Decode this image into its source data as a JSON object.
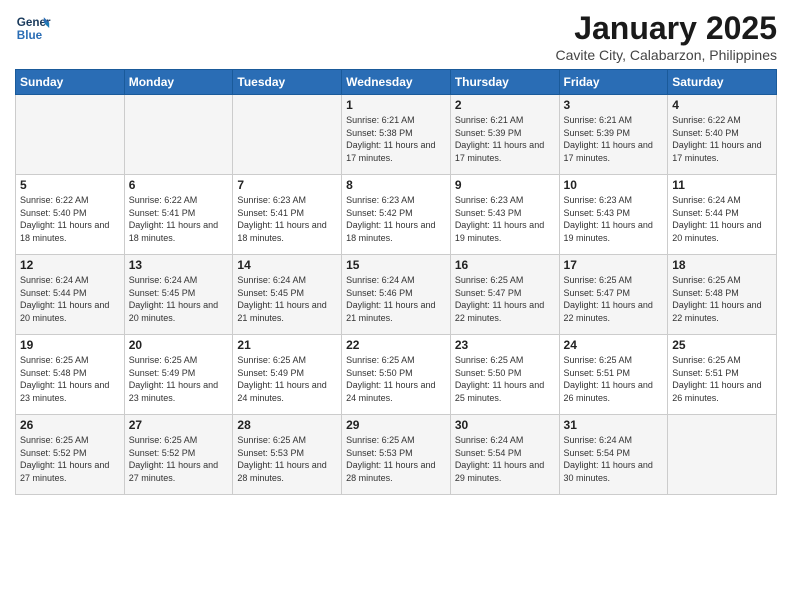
{
  "logo": {
    "line1": "General",
    "line2": "Blue"
  },
  "title": "January 2025",
  "subtitle": "Cavite City, Calabarzon, Philippines",
  "days_of_week": [
    "Sunday",
    "Monday",
    "Tuesday",
    "Wednesday",
    "Thursday",
    "Friday",
    "Saturday"
  ],
  "weeks": [
    [
      {
        "day": "",
        "sunrise": "",
        "sunset": "",
        "daylight": ""
      },
      {
        "day": "",
        "sunrise": "",
        "sunset": "",
        "daylight": ""
      },
      {
        "day": "",
        "sunrise": "",
        "sunset": "",
        "daylight": ""
      },
      {
        "day": "1",
        "sunrise": "Sunrise: 6:21 AM",
        "sunset": "Sunset: 5:38 PM",
        "daylight": "Daylight: 11 hours and 17 minutes."
      },
      {
        "day": "2",
        "sunrise": "Sunrise: 6:21 AM",
        "sunset": "Sunset: 5:39 PM",
        "daylight": "Daylight: 11 hours and 17 minutes."
      },
      {
        "day": "3",
        "sunrise": "Sunrise: 6:21 AM",
        "sunset": "Sunset: 5:39 PM",
        "daylight": "Daylight: 11 hours and 17 minutes."
      },
      {
        "day": "4",
        "sunrise": "Sunrise: 6:22 AM",
        "sunset": "Sunset: 5:40 PM",
        "daylight": "Daylight: 11 hours and 17 minutes."
      }
    ],
    [
      {
        "day": "5",
        "sunrise": "Sunrise: 6:22 AM",
        "sunset": "Sunset: 5:40 PM",
        "daylight": "Daylight: 11 hours and 18 minutes."
      },
      {
        "day": "6",
        "sunrise": "Sunrise: 6:22 AM",
        "sunset": "Sunset: 5:41 PM",
        "daylight": "Daylight: 11 hours and 18 minutes."
      },
      {
        "day": "7",
        "sunrise": "Sunrise: 6:23 AM",
        "sunset": "Sunset: 5:41 PM",
        "daylight": "Daylight: 11 hours and 18 minutes."
      },
      {
        "day": "8",
        "sunrise": "Sunrise: 6:23 AM",
        "sunset": "Sunset: 5:42 PM",
        "daylight": "Daylight: 11 hours and 18 minutes."
      },
      {
        "day": "9",
        "sunrise": "Sunrise: 6:23 AM",
        "sunset": "Sunset: 5:43 PM",
        "daylight": "Daylight: 11 hours and 19 minutes."
      },
      {
        "day": "10",
        "sunrise": "Sunrise: 6:23 AM",
        "sunset": "Sunset: 5:43 PM",
        "daylight": "Daylight: 11 hours and 19 minutes."
      },
      {
        "day": "11",
        "sunrise": "Sunrise: 6:24 AM",
        "sunset": "Sunset: 5:44 PM",
        "daylight": "Daylight: 11 hours and 20 minutes."
      }
    ],
    [
      {
        "day": "12",
        "sunrise": "Sunrise: 6:24 AM",
        "sunset": "Sunset: 5:44 PM",
        "daylight": "Daylight: 11 hours and 20 minutes."
      },
      {
        "day": "13",
        "sunrise": "Sunrise: 6:24 AM",
        "sunset": "Sunset: 5:45 PM",
        "daylight": "Daylight: 11 hours and 20 minutes."
      },
      {
        "day": "14",
        "sunrise": "Sunrise: 6:24 AM",
        "sunset": "Sunset: 5:45 PM",
        "daylight": "Daylight: 11 hours and 21 minutes."
      },
      {
        "day": "15",
        "sunrise": "Sunrise: 6:24 AM",
        "sunset": "Sunset: 5:46 PM",
        "daylight": "Daylight: 11 hours and 21 minutes."
      },
      {
        "day": "16",
        "sunrise": "Sunrise: 6:25 AM",
        "sunset": "Sunset: 5:47 PM",
        "daylight": "Daylight: 11 hours and 22 minutes."
      },
      {
        "day": "17",
        "sunrise": "Sunrise: 6:25 AM",
        "sunset": "Sunset: 5:47 PM",
        "daylight": "Daylight: 11 hours and 22 minutes."
      },
      {
        "day": "18",
        "sunrise": "Sunrise: 6:25 AM",
        "sunset": "Sunset: 5:48 PM",
        "daylight": "Daylight: 11 hours and 22 minutes."
      }
    ],
    [
      {
        "day": "19",
        "sunrise": "Sunrise: 6:25 AM",
        "sunset": "Sunset: 5:48 PM",
        "daylight": "Daylight: 11 hours and 23 minutes."
      },
      {
        "day": "20",
        "sunrise": "Sunrise: 6:25 AM",
        "sunset": "Sunset: 5:49 PM",
        "daylight": "Daylight: 11 hours and 23 minutes."
      },
      {
        "day": "21",
        "sunrise": "Sunrise: 6:25 AM",
        "sunset": "Sunset: 5:49 PM",
        "daylight": "Daylight: 11 hours and 24 minutes."
      },
      {
        "day": "22",
        "sunrise": "Sunrise: 6:25 AM",
        "sunset": "Sunset: 5:50 PM",
        "daylight": "Daylight: 11 hours and 24 minutes."
      },
      {
        "day": "23",
        "sunrise": "Sunrise: 6:25 AM",
        "sunset": "Sunset: 5:50 PM",
        "daylight": "Daylight: 11 hours and 25 minutes."
      },
      {
        "day": "24",
        "sunrise": "Sunrise: 6:25 AM",
        "sunset": "Sunset: 5:51 PM",
        "daylight": "Daylight: 11 hours and 26 minutes."
      },
      {
        "day": "25",
        "sunrise": "Sunrise: 6:25 AM",
        "sunset": "Sunset: 5:51 PM",
        "daylight": "Daylight: 11 hours and 26 minutes."
      }
    ],
    [
      {
        "day": "26",
        "sunrise": "Sunrise: 6:25 AM",
        "sunset": "Sunset: 5:52 PM",
        "daylight": "Daylight: 11 hours and 27 minutes."
      },
      {
        "day": "27",
        "sunrise": "Sunrise: 6:25 AM",
        "sunset": "Sunset: 5:52 PM",
        "daylight": "Daylight: 11 hours and 27 minutes."
      },
      {
        "day": "28",
        "sunrise": "Sunrise: 6:25 AM",
        "sunset": "Sunset: 5:53 PM",
        "daylight": "Daylight: 11 hours and 28 minutes."
      },
      {
        "day": "29",
        "sunrise": "Sunrise: 6:25 AM",
        "sunset": "Sunset: 5:53 PM",
        "daylight": "Daylight: 11 hours and 28 minutes."
      },
      {
        "day": "30",
        "sunrise": "Sunrise: 6:24 AM",
        "sunset": "Sunset: 5:54 PM",
        "daylight": "Daylight: 11 hours and 29 minutes."
      },
      {
        "day": "31",
        "sunrise": "Sunrise: 6:24 AM",
        "sunset": "Sunset: 5:54 PM",
        "daylight": "Daylight: 11 hours and 30 minutes."
      },
      {
        "day": "",
        "sunrise": "",
        "sunset": "",
        "daylight": ""
      }
    ]
  ]
}
